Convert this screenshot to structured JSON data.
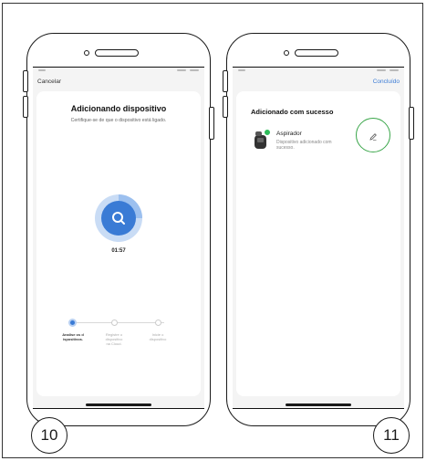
{
  "left_screen": {
    "cancel_label": "Cancelar",
    "title": "Adicionando dispositivo",
    "subtitle": "Certifique-se de que o dispositivo está ligado.",
    "timer": "01:57",
    "steps": [
      {
        "label_l1": "Analise os d",
        "label_l2": "ispositivos.",
        "label_l3": ""
      },
      {
        "label_l1": "Registre o",
        "label_l2": "dispositivo",
        "label_l3": "na Cloud."
      },
      {
        "label_l1": "Inicie o",
        "label_l2": "dispositivo",
        "label_l3": ""
      }
    ],
    "active_step": 1
  },
  "right_screen": {
    "done_label": "Concluído",
    "title": "Adicionado com sucesso",
    "device_name": "Aspirador",
    "device_status_l1": "Dispositivo adicionado com",
    "device_status_l2": "sucesso."
  },
  "step_numbers": {
    "left": "10",
    "right": "11"
  },
  "colors": {
    "accent": "#3a7bd5",
    "highlight_ring": "#3aa64a",
    "success_badge": "#2ebd5a"
  },
  "icons": {
    "search": "search-icon",
    "edit": "pencil-icon"
  }
}
